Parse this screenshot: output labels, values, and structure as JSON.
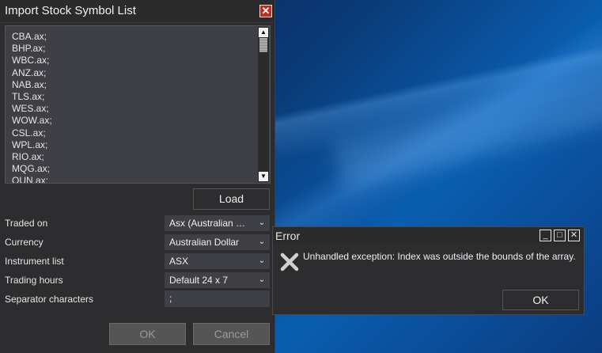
{
  "import_dialog": {
    "title": "Import Stock Symbol List",
    "close_glyph": "✕",
    "symbols": [
      "CBA.ax;",
      "BHP.ax;",
      "WBC.ax;",
      "ANZ.ax;",
      "NAB.ax;",
      "TLS.ax;",
      "WES.ax;",
      "WOW.ax;",
      "CSL.ax;",
      "WPL.ax;",
      "RIO.ax;",
      "MQG.ax;",
      "QUN.ax;"
    ],
    "load_label": "Load",
    "fields": {
      "traded_on": {
        "label": "Traded on",
        "value": "Asx (Australian St..."
      },
      "currency": {
        "label": "Currency",
        "value": "Australian Dollar"
      },
      "instrument_list": {
        "label": "Instrument list",
        "value": "ASX"
      },
      "trading_hours": {
        "label": "Trading hours",
        "value": "Default 24 x 7"
      },
      "separator": {
        "label": "Separator characters",
        "value": ";"
      }
    },
    "ok_label": "OK",
    "cancel_label": "Cancel"
  },
  "error_dialog": {
    "title": "Error",
    "message": "Unhandled exception: Index was outside the bounds of the array.",
    "ok_label": "OK",
    "icon": "error-x-icon"
  },
  "colors": {
    "dialog_bg": "#2d2d30",
    "input_bg": "#3f3f46",
    "close_red": "#c42b1c",
    "desktop_blue": "#0a5eb0"
  }
}
